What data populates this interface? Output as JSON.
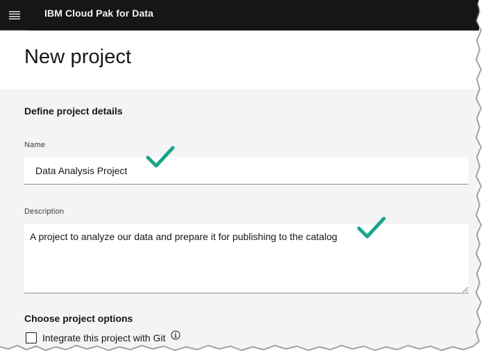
{
  "header": {
    "menu_icon": "hamburger-menu-icon",
    "brand": "IBM Cloud Pak for Data"
  },
  "page": {
    "title": "New project"
  },
  "form": {
    "define_heading": "Define project details",
    "name": {
      "label": "Name",
      "value": "Data Analysis Project"
    },
    "description": {
      "label": "Description",
      "value": "A project to analyze our data and prepare it for publishing to the catalog"
    },
    "options_heading": "Choose project options",
    "git_option": {
      "label": "Integrate this project with Git",
      "checked": false,
      "info_icon": "information-icon"
    }
  },
  "annotations": {
    "checkmark_icon": "checkmark-icon",
    "checkmark_color": "#1ba58c"
  },
  "colors": {
    "header_bg": "#161616",
    "form_bg": "#f4f4f4",
    "field_bg": "#ffffff",
    "text": "#161616"
  }
}
